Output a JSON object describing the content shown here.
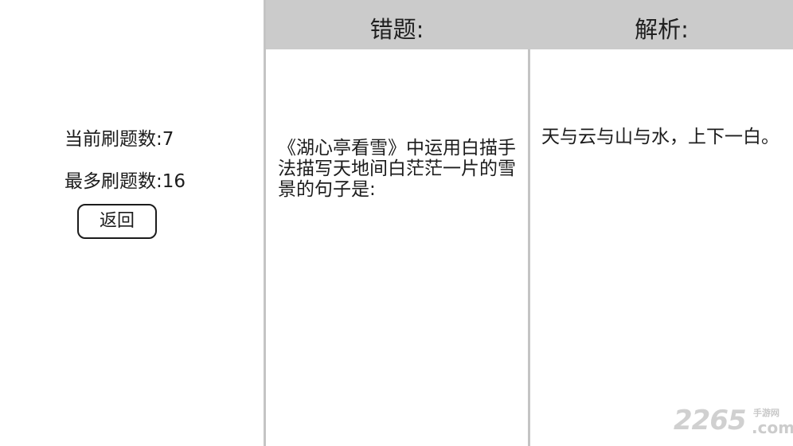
{
  "stats": {
    "current_label": "当前刷题数:7",
    "best_label": "最多刷题数:16"
  },
  "actions": {
    "back_label": "返回"
  },
  "header": {
    "wrong_question": "错题:",
    "analysis": "解析:"
  },
  "content": {
    "question": "《湖心亭看雪》中运用白描手法描写天地间白茫茫一片的雪景的句子是:",
    "answer": "天与云与山与水，上下一白。"
  },
  "watermark": {
    "digits": "2265",
    "cn_text": "手游网",
    "domain": ".com"
  },
  "colors": {
    "header_bg": "#cbcbcb",
    "divider": "#c4c4c4",
    "text": "#1c1c1c",
    "watermark": "#d0d0d0"
  }
}
